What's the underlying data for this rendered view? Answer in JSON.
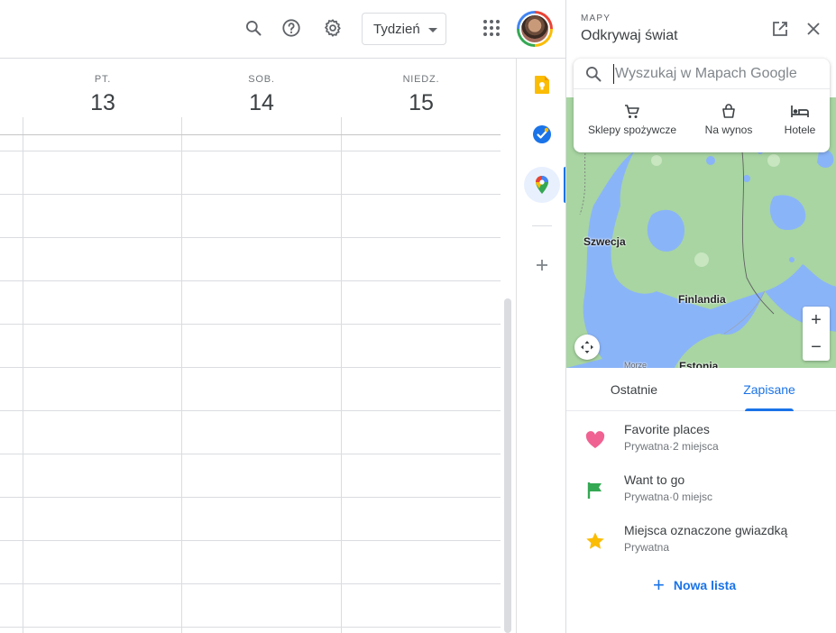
{
  "header": {
    "view_selector": "Tydzień",
    "icons": [
      "search-icon",
      "help-icon",
      "settings-icon",
      "apps-icon"
    ]
  },
  "calendar": {
    "days": [
      {
        "name": "PT.",
        "number": "13"
      },
      {
        "name": "SOB.",
        "number": "14"
      },
      {
        "name": "NIEDZ.",
        "number": "15"
      }
    ]
  },
  "side_rail": {
    "items": [
      "keep-icon",
      "tasks-icon",
      "maps-icon",
      "add-icon"
    ]
  },
  "maps_panel": {
    "subtitle": "MAPY",
    "title": "Odkrywaj świat",
    "search_placeholder": "Wyszukaj w Mapach Google",
    "categories": [
      {
        "label": "Sklepy spożywcze",
        "icon": "cart-icon"
      },
      {
        "label": "Na wynos",
        "icon": "takeout-icon"
      },
      {
        "label": "Hotele",
        "icon": "hotel-icon"
      }
    ],
    "map_labels": {
      "sweden": "Szwecja",
      "finland": "Finlandia",
      "estonia": "Estonia",
      "sea": "Morze"
    },
    "tabs": [
      "Ostatnie",
      "Zapisane"
    ],
    "active_tab": "Zapisane",
    "lists": [
      {
        "title": "Favorite places",
        "subtitle": "Prywatna·2 miejsca",
        "icon": "heart-icon",
        "color": "#f06292"
      },
      {
        "title": "Want to go",
        "subtitle": "Prywatna·0 miejsc",
        "icon": "flag-icon",
        "color": "#34a853"
      },
      {
        "title": "Miejsca oznaczone gwiazdką",
        "subtitle": "Prywatna",
        "icon": "star-icon",
        "color": "#fbbc04"
      }
    ],
    "new_list_label": "Nowa lista"
  },
  "colors": {
    "accent": "#1a73e8",
    "map_land": "#a8d5a2",
    "map_water": "#8ab4f8"
  }
}
